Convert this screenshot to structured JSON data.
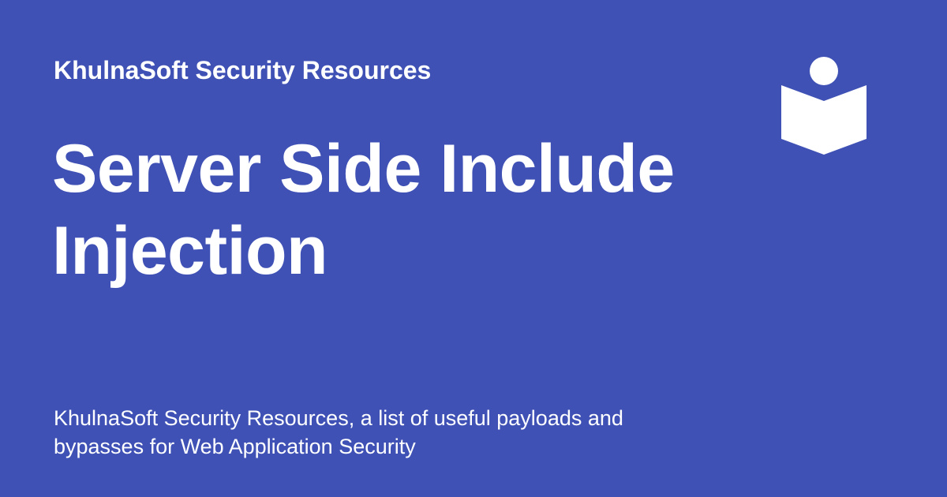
{
  "site_name": "KhulnaSoft Security Resources",
  "page_title": "Server Side Include Injection",
  "description": "KhulnaSoft Security Resources, a list of useful payloads and bypasses for Web Application Security",
  "logo_icon": "book-reader-icon",
  "colors": {
    "background": "#3f51b5",
    "text": "#ffffff"
  }
}
